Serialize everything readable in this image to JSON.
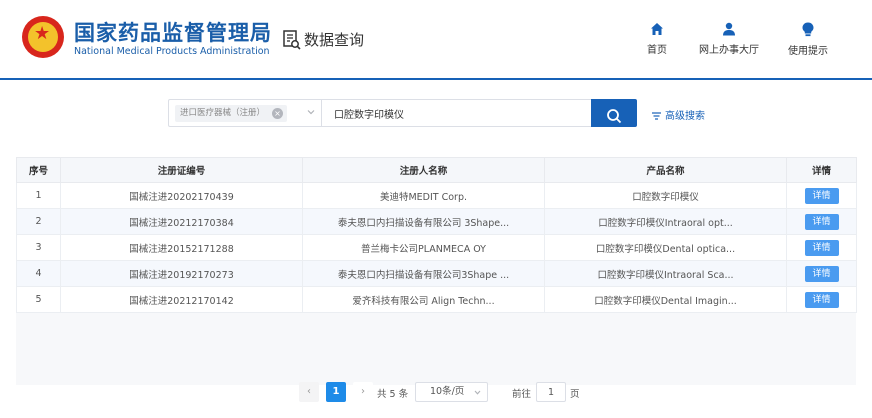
{
  "header": {
    "logo_cn": "国家药品监督管理局",
    "logo_en": "National Medical Products Administration",
    "query_title": "数据查询",
    "nav": [
      {
        "label": "首页",
        "icon": "home-icon"
      },
      {
        "label": "网上办事大厅",
        "icon": "user-icon"
      },
      {
        "label": "使用提示",
        "icon": "lightbulb-icon"
      }
    ]
  },
  "search": {
    "category_tag": "进口医疗器械（注册）",
    "query_value": "口腔数字印模仪",
    "advanced_label": "高级搜索"
  },
  "table": {
    "columns": [
      "序号",
      "注册证编号",
      "注册人名称",
      "产品名称",
      "详情"
    ],
    "rows": [
      {
        "no": "1",
        "reg_no": "国械注进20202170439",
        "registrant": "美迪特MEDIT Corp.",
        "product": "口腔数字印模仪",
        "detail": "详情"
      },
      {
        "no": "2",
        "reg_no": "国械注进20212170384",
        "registrant": "泰夫恩口内扫描设备有限公司 3Shape...",
        "product": "口腔数字印模仪Intraoral opt...",
        "detail": "详情"
      },
      {
        "no": "3",
        "reg_no": "国械注进20152171288",
        "registrant": "普兰梅卡公司PLANMECA OY",
        "product": "口腔数字印模仪Dental optica...",
        "detail": "详情"
      },
      {
        "no": "4",
        "reg_no": "国械注进20192170273",
        "registrant": "泰夫恩口内扫描设备有限公司3Shape ...",
        "product": "口腔数字印模仪Intraoral Sca...",
        "detail": "详情"
      },
      {
        "no": "5",
        "reg_no": "国械注进20212170142",
        "registrant": "爱齐科技有限公司 Align Techn...",
        "product": "口腔数字印模仪Dental Imagin...",
        "detail": "详情"
      }
    ]
  },
  "pagination": {
    "prev": "‹",
    "current": "1",
    "next": "›",
    "total": "共 5 条",
    "page_size": "10条/页",
    "goto_label": "前往",
    "goto_value": "1",
    "page_unit": "页"
  },
  "colors": {
    "brand": "#1761b7",
    "accent": "#1e8be8",
    "detail_button": "#4a9bf0"
  }
}
